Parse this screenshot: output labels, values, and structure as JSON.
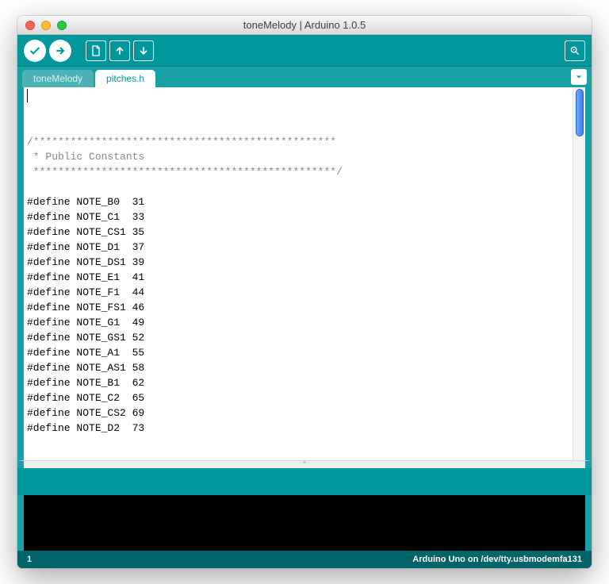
{
  "window": {
    "title": "toneMelody | Arduino 1.0.5"
  },
  "toolbar": {
    "verify": "Verify",
    "upload": "Upload",
    "new": "New",
    "open": "Open",
    "save": "Save",
    "serial": "Serial Monitor"
  },
  "tabs": {
    "items": [
      {
        "label": "toneMelody",
        "active": false
      },
      {
        "label": "pitches.h",
        "active": true
      }
    ]
  },
  "editor": {
    "lines": [
      {
        "cls": "comment",
        "text": "/*************************************************"
      },
      {
        "cls": "comment",
        "text": " * Public Constants"
      },
      {
        "cls": "comment",
        "text": " *************************************************/"
      },
      {
        "cls": "",
        "text": ""
      },
      {
        "cls": "",
        "text": "#define NOTE_B0  31"
      },
      {
        "cls": "",
        "text": "#define NOTE_C1  33"
      },
      {
        "cls": "",
        "text": "#define NOTE_CS1 35"
      },
      {
        "cls": "",
        "text": "#define NOTE_D1  37"
      },
      {
        "cls": "",
        "text": "#define NOTE_DS1 39"
      },
      {
        "cls": "",
        "text": "#define NOTE_E1  41"
      },
      {
        "cls": "",
        "text": "#define NOTE_F1  44"
      },
      {
        "cls": "",
        "text": "#define NOTE_FS1 46"
      },
      {
        "cls": "",
        "text": "#define NOTE_G1  49"
      },
      {
        "cls": "",
        "text": "#define NOTE_GS1 52"
      },
      {
        "cls": "",
        "text": "#define NOTE_A1  55"
      },
      {
        "cls": "",
        "text": "#define NOTE_AS1 58"
      },
      {
        "cls": "",
        "text": "#define NOTE_B1  62"
      },
      {
        "cls": "",
        "text": "#define NOTE_C2  65"
      },
      {
        "cls": "",
        "text": "#define NOTE_CS2 69"
      },
      {
        "cls": "",
        "text": "#define NOTE_D2  73"
      }
    ]
  },
  "status": {
    "line": "1",
    "board": "Arduino Uno on /dev/tty.usbmodemfa131"
  },
  "resize_hint": "⌃"
}
